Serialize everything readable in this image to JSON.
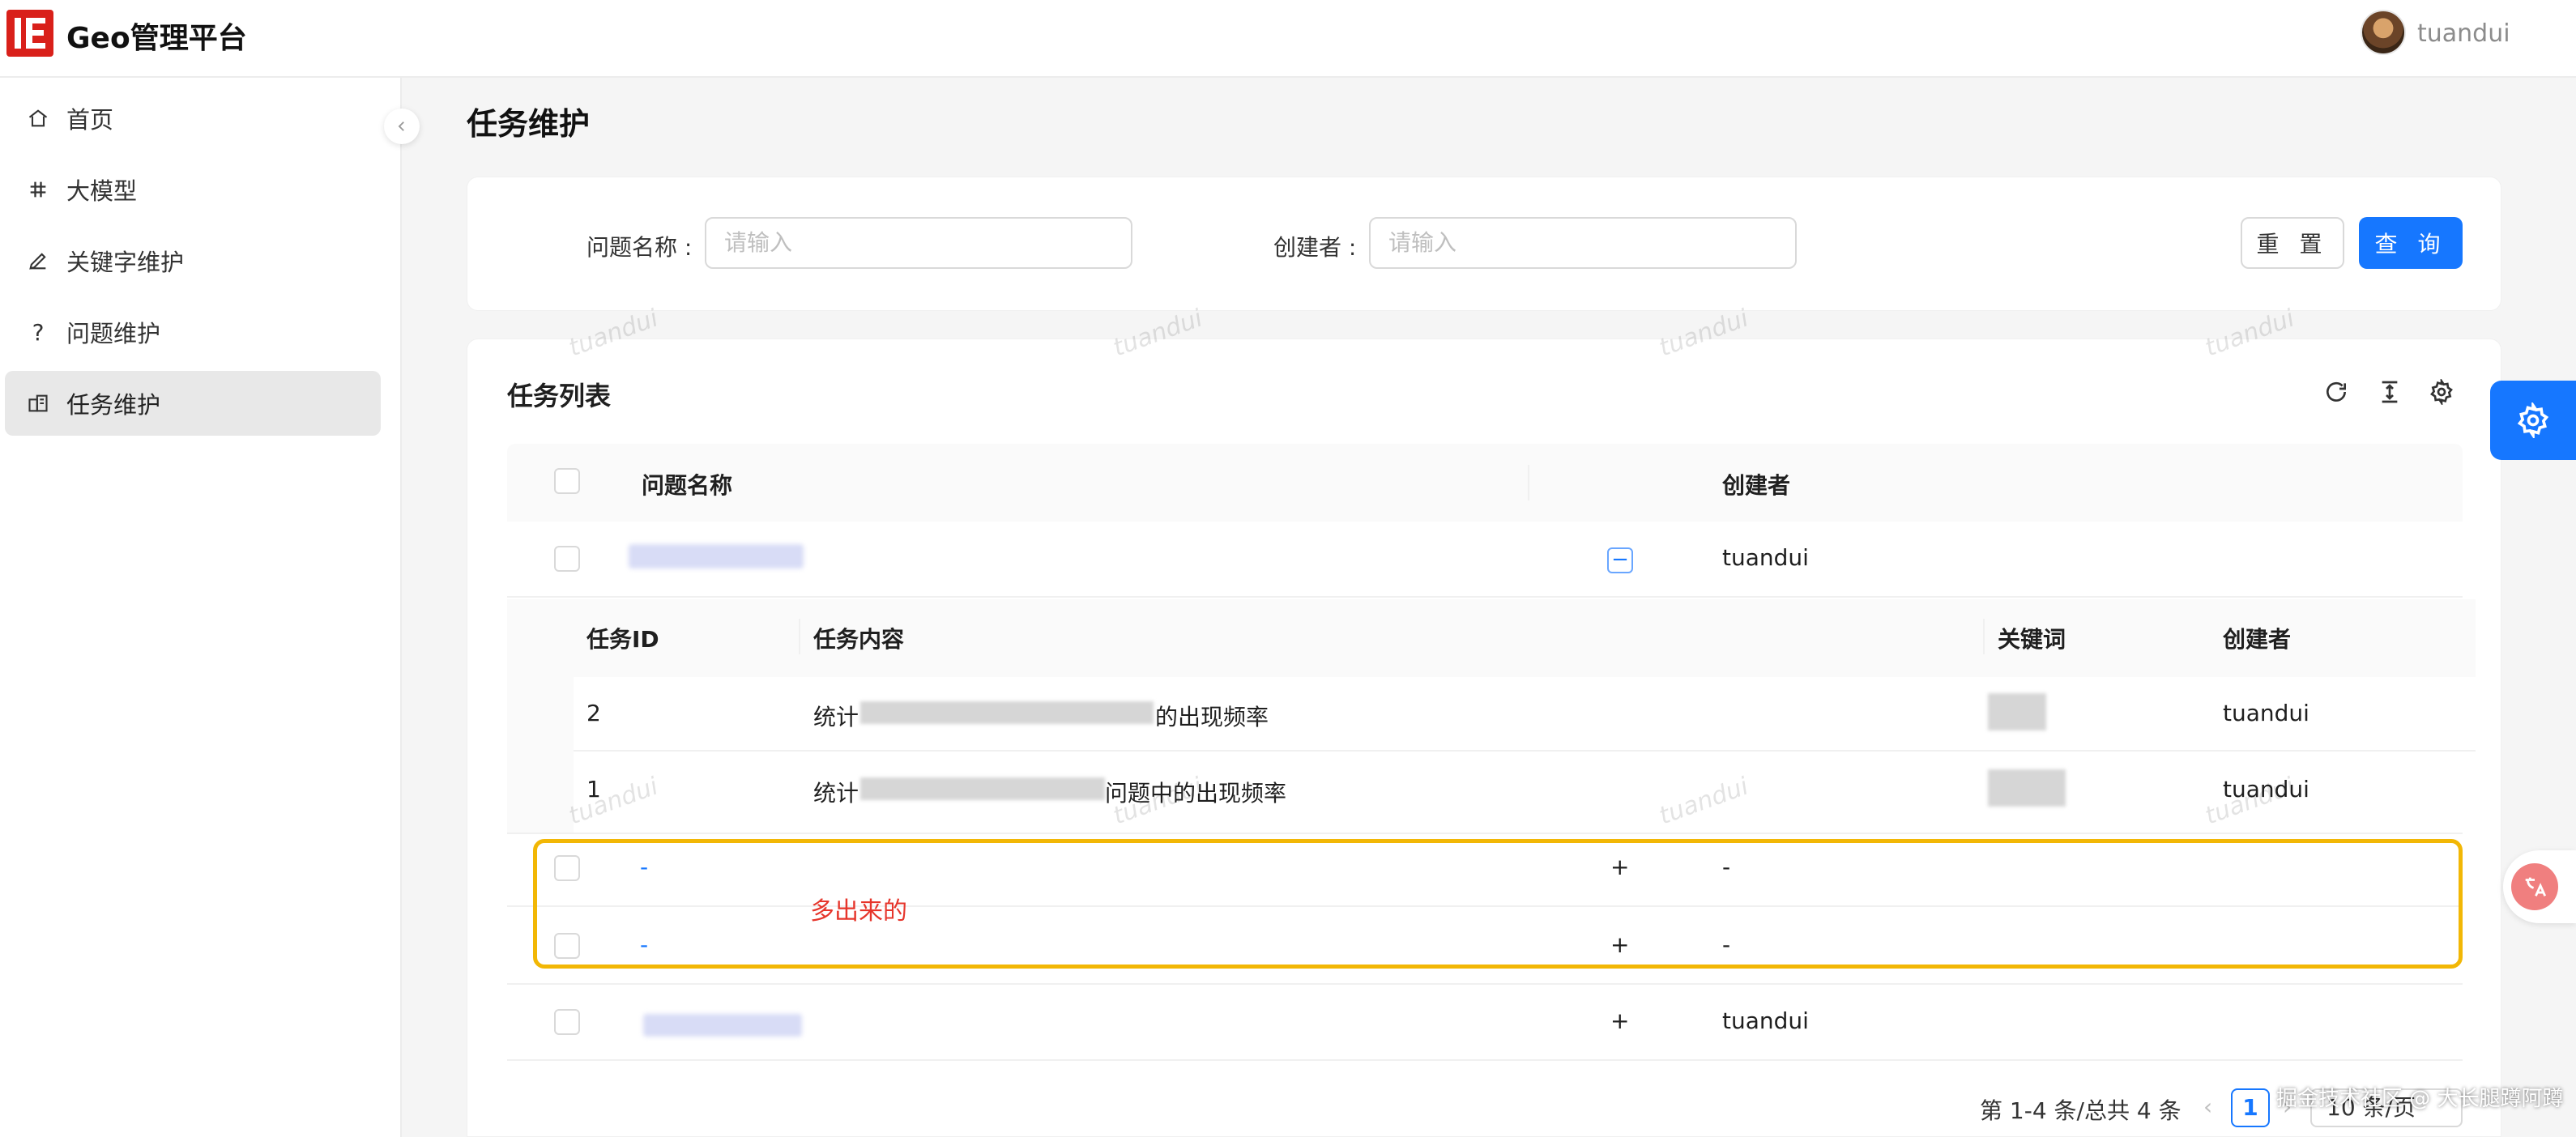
{
  "app": {
    "title": "Geo管理平台",
    "user": "tuandui"
  },
  "sidebar": {
    "items": [
      {
        "label": "首页",
        "icon": "home-icon"
      },
      {
        "label": "大模型",
        "icon": "model-icon"
      },
      {
        "label": "关键字维护",
        "icon": "edit-icon"
      },
      {
        "label": "问题维护",
        "icon": "question-icon"
      },
      {
        "label": "任务维护",
        "icon": "task-icon",
        "active": true
      }
    ]
  },
  "page": {
    "title": "任务维护"
  },
  "search": {
    "name_label": "问题名称 :",
    "name_placeholder": "请输入",
    "creator_label": "创建者 :",
    "creator_placeholder": "请输入",
    "reset": "重 置",
    "query": "查 询"
  },
  "table": {
    "title": "任务列表",
    "headers": {
      "name": "问题名称",
      "creator": "创建者"
    },
    "rows": [
      {
        "creator": "tuandui",
        "expanded": true
      },
      {
        "name": "-",
        "creator": "-"
      },
      {
        "name": "-",
        "creator": "-"
      },
      {
        "creator": "tuandui"
      }
    ],
    "nested": {
      "headers": {
        "id": "任务ID",
        "content": "任务内容",
        "keyword": "关键词",
        "creator": "创建者"
      },
      "rows": [
        {
          "id": "2",
          "content_prefix": "统计",
          "content_suffix": "的出现频率",
          "creator": "tuandui"
        },
        {
          "id": "1",
          "content_prefix": "统计",
          "content_suffix": "问题中的出现频率",
          "creator": "tuandui"
        }
      ]
    },
    "annotation": "多出来的"
  },
  "pagination": {
    "summary": "第 1-4 条/总共 4 条",
    "current": "1",
    "page_size": "10 条/页"
  },
  "watermark": "tuandui",
  "credit": "掘金技术社区 @ 大长腿蹲阿蹲",
  "colors": {
    "primary": "#1677ff",
    "highlight": "#f2b705",
    "annotation": "#e6352b",
    "logo": "#d9201a"
  }
}
